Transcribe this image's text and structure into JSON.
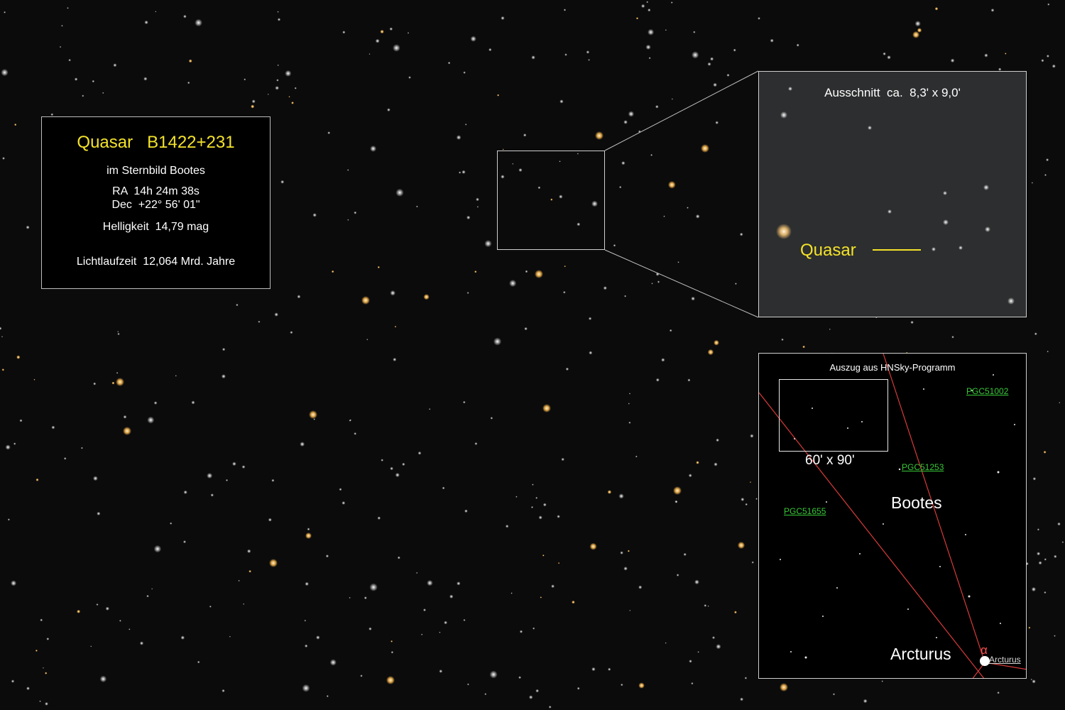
{
  "info": {
    "title": "Quasar   B1422+231",
    "constellation": "im Sternbild Bootes",
    "ra": "RA  14h 24m 38s",
    "dec": "Dec  +22° 56' 01\"",
    "brightness": "Helligkeit  14,79 mag",
    "light_travel": "Lichtlaufzeit  12,064 Mrd. Jahre"
  },
  "zoom": {
    "caption": "Ausschnitt  ca.  8,3' x 9,0'",
    "quasar_label": "Quasar"
  },
  "chart": {
    "title": "Auszug aus HNSky-Programm",
    "fov_label": "60' x 90'",
    "galaxies": [
      "PGC51002",
      "PGC51253",
      "PGC51655"
    ],
    "constellation_label": "Bootes",
    "star_label": "Arcturus",
    "star_small_label": "Arcturus",
    "alpha_symbol": "α"
  },
  "colors": {
    "highlight": "#f3e22a",
    "galaxy_link": "#38c938",
    "constellation_line": "#d83a3a",
    "sky": "#0b0b0c"
  }
}
